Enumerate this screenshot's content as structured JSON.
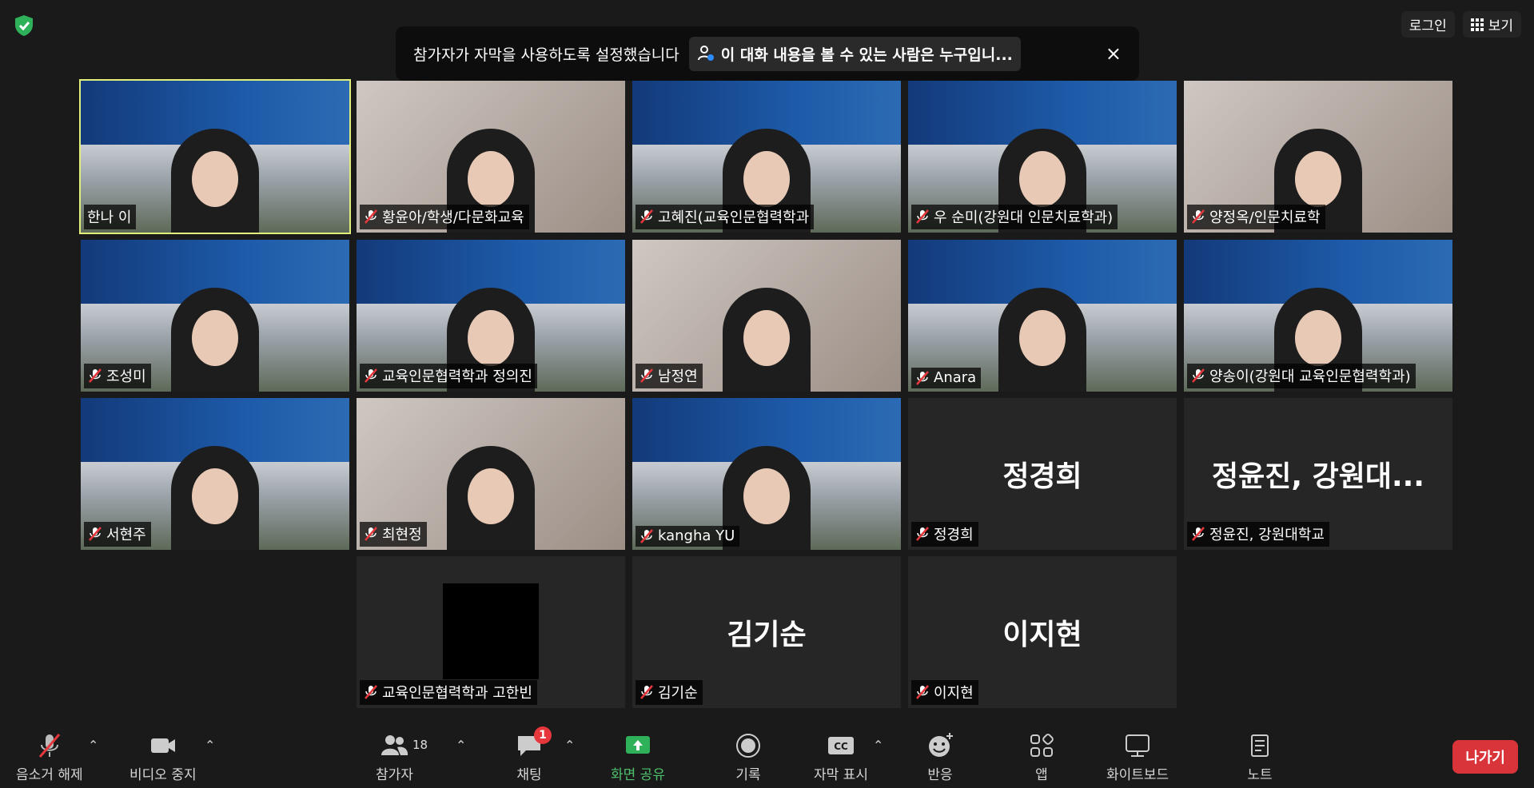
{
  "header": {
    "login_label": "로그인",
    "view_label": "보기"
  },
  "notice": {
    "text": "참가자가 자막을 사용하도록 설정했습니다",
    "who_label": "이 대화 내용을 볼 수 있는 사람은 누구입니...",
    "close": "×"
  },
  "tiles": [
    {
      "name": "한나 이",
      "type": "slide",
      "muted": false,
      "active": true
    },
    {
      "name": "황윤아/학생/다문화교육",
      "type": "video",
      "muted": true
    },
    {
      "name": "고혜진(교육인문협력학과",
      "type": "slide",
      "muted": true
    },
    {
      "name": "우 순미(강원대 인문치료학과)",
      "type": "slide",
      "muted": true
    },
    {
      "name": "양정옥/인문치료학",
      "type": "video",
      "muted": true
    },
    {
      "name": "조성미",
      "type": "slide",
      "muted": true
    },
    {
      "name": "교육인문협력학과 정의진",
      "type": "slide",
      "muted": true
    },
    {
      "name": "남정연",
      "type": "video",
      "muted": true
    },
    {
      "name": "Anara",
      "type": "slide",
      "muted": true
    },
    {
      "name": "양송이(강원대 교육인문협력학과)",
      "type": "slide",
      "muted": true
    },
    {
      "name": "서현주",
      "type": "slide",
      "muted": true
    },
    {
      "name": "최현정",
      "type": "video",
      "muted": true
    },
    {
      "name": "kangha YU",
      "type": "slide",
      "muted": true
    },
    {
      "name": "정경희",
      "type": "name",
      "big": "정경희",
      "muted": true
    },
    {
      "name": "정윤진, 강원대학교",
      "type": "name",
      "big": "정윤진, 강원대...",
      "muted": true
    },
    {
      "name": "교육인문협력학과 고한빈",
      "type": "black",
      "muted": true
    },
    {
      "name": "김기순",
      "type": "name",
      "big": "김기순",
      "muted": true
    },
    {
      "name": "이지현",
      "type": "name",
      "big": "이지현",
      "muted": true
    }
  ],
  "toolbar": {
    "unmute": "음소거 해제",
    "stop_video": "비디오 중지",
    "participants": "참가자",
    "participants_count": "18",
    "chat": "채팅",
    "chat_badge": "1",
    "share": "화면 공유",
    "record": "기록",
    "captions": "자막 표시",
    "reactions": "반응",
    "apps": "앱",
    "whiteboard": "화이트보드",
    "notes": "노트",
    "leave": "나가기"
  },
  "colors": {
    "active_outline": "#e2ef7a",
    "leave_red": "#d9343a",
    "share_green": "#4ec06b",
    "shield_green": "#2fb15a"
  }
}
